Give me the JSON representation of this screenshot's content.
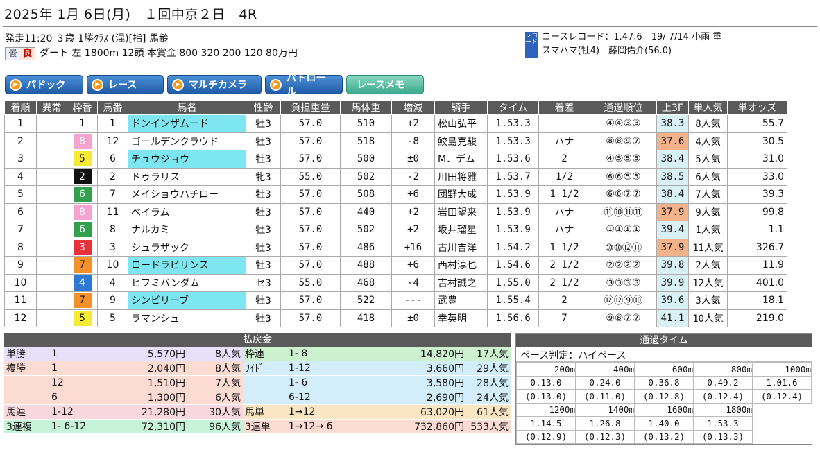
{
  "header": {
    "title": "2025年 1月 6日(月)　１回中京２日　4R"
  },
  "race": {
    "line1": "発走11:20 ３歳 1勝ｸﾗｽ (混)[指] 馬齢",
    "weather": "曇",
    "track_cond": "良",
    "line2": "ダート 左 1800m 12頭 本賞金 800 320 200 120 80万円"
  },
  "record": {
    "tag": "レコード",
    "line1": "コースレコード：1.47.6　19/ 7/14 小雨 重",
    "line2": "スマハマ(牡4)　藤岡佑介(56.0)"
  },
  "buttons": [
    "パドック",
    "レース",
    "マルチカメラ",
    "パトロール",
    "レースメモ"
  ],
  "columns": [
    "着順",
    "異常",
    "枠番",
    "馬番",
    "馬名",
    "性齢",
    "負担重量",
    "馬体重",
    "増減",
    "騎手",
    "タイム",
    "着差",
    "通過順位",
    "上3F",
    "単人気",
    "単オッズ"
  ],
  "rows": [
    [
      "1",
      "",
      "1",
      "1",
      "ドンインザムード",
      "牡3",
      "57.0",
      "510",
      "+2",
      "松山弘平",
      "1.53.3",
      "",
      "④④③③",
      "38.3",
      "8人気",
      "55.7"
    ],
    [
      "2",
      "",
      "8",
      "12",
      "ゴールデンクラウド",
      "牡3",
      "57.0",
      "518",
      "-8",
      "鮫島克駿",
      "1.53.3",
      "ハナ",
      "⑧⑧⑨⑦",
      "37.6",
      "4人気",
      "30.5"
    ],
    [
      "3",
      "",
      "5",
      "6",
      "チュウジョウ",
      "牡3",
      "57.0",
      "500",
      "±0",
      "M．デム",
      "1.53.6",
      "2",
      "④⑤⑤⑤",
      "38.4",
      "5人気",
      "31.0"
    ],
    [
      "4",
      "",
      "2",
      "2",
      "ドゥラリス",
      "牝3",
      "55.0",
      "502",
      "-2",
      "川田将雅",
      "1.53.7",
      "1/2",
      "⑥⑥⑤⑤",
      "38.5",
      "6人気",
      "33.0"
    ],
    [
      "5",
      "",
      "6",
      "7",
      "メイショウハチロー",
      "牡3",
      "57.0",
      "508",
      "+6",
      "団野大成",
      "1.53.9",
      "1 1/2",
      "⑥⑥⑦⑦",
      "38.4",
      "7人気",
      "39.3"
    ],
    [
      "6",
      "",
      "8",
      "11",
      "ベイラム",
      "牡3",
      "57.0",
      "440",
      "+2",
      "岩田望来",
      "1.53.9",
      "ハナ",
      "⑪⑩⑪⑪",
      "37.9",
      "9人気",
      "99.8"
    ],
    [
      "7",
      "",
      "6",
      "8",
      "ナルカミ",
      "牡3",
      "57.0",
      "502",
      "+2",
      "坂井瑠星",
      "1.53.9",
      "ハナ",
      "①①①①",
      "39.4",
      "1人気",
      "1.1"
    ],
    [
      "8",
      "",
      "3",
      "3",
      "シュラザック",
      "牡3",
      "57.0",
      "486",
      "+16",
      "古川吉洋",
      "1.54.2",
      "1 1/2",
      "⑩⑩⑫⑪",
      "37.9",
      "11人気",
      "326.7"
    ],
    [
      "9",
      "",
      "7",
      "10",
      "ロードラビリンス",
      "牡3",
      "57.0",
      "488",
      "+6",
      "西村淳也",
      "1.54.6",
      "2 1/2",
      "②②②②",
      "39.8",
      "2人気",
      "11.9"
    ],
    [
      "10",
      "",
      "4",
      "4",
      "ヒフミバンダム",
      "セ3",
      "55.0",
      "468",
      "-4",
      "吉村誠之",
      "1.55.0",
      "2 1/2",
      "③③③③",
      "39.9",
      "12人気",
      "401.0"
    ],
    [
      "11",
      "",
      "7",
      "9",
      "シンビリーブ",
      "牡3",
      "57.0",
      "522",
      "---",
      "武豊",
      "1.55.4",
      "2",
      "⑫⑫⑨⑩",
      "39.6",
      "3人気",
      "18.1"
    ],
    [
      "12",
      "",
      "5",
      "5",
      "ラマンシュ",
      "牡3",
      "57.0",
      "418",
      "±0",
      "幸英明",
      "1.56.6",
      "7",
      "⑨⑧⑦⑦",
      "41.1",
      "10人気",
      "219.0"
    ]
  ],
  "highlight_names": [
    0,
    2,
    8,
    10
  ],
  "f3_colors": {
    "0": "light",
    "1": "orange",
    "2": "light",
    "3": "light",
    "4": "light",
    "5": "orange",
    "6": "light",
    "7": "orange",
    "8": "light",
    "9": "light",
    "10": "light",
    "11": "light"
  },
  "waku_colors": {
    "1": "#ffffff",
    "2": "#111111",
    "3": "#e8323c",
    "4": "#2f78d6",
    "5": "#f7ea36",
    "6": "#33a04d",
    "7": "#f5902a",
    "8": "#f6a3cf"
  },
  "payout": {
    "title": "払戻金",
    "rows": [
      {
        "bg": "#e6e0fb",
        "a": [
          "単勝",
          "1",
          "5,570円",
          "8人気"
        ],
        "bg2": "#cdf1cf",
        "b": [
          "枠連",
          "1- 8",
          "14,820円",
          "17人気"
        ]
      },
      {
        "bg": "#fbdbd2",
        "a": [
          "複勝",
          "1",
          "2,040円",
          "8人気"
        ],
        "bg2": "#d3eefa",
        "b": [
          "ﾜｲﾄﾞ",
          "1-12",
          "3,660円",
          "29人気"
        ]
      },
      {
        "bg": "#fbdbd2",
        "a": [
          "",
          "12",
          "1,510円",
          "7人気"
        ],
        "bg2": "#d3eefa",
        "b": [
          "",
          "1- 6",
          "3,580円",
          "28人気"
        ]
      },
      {
        "bg": "#fbdbd2",
        "a": [
          "",
          "6",
          "1,300円",
          "6人気"
        ],
        "bg2": "#d3eefa",
        "b": [
          "",
          "6-12",
          "2,690円",
          "24人気"
        ]
      },
      {
        "bg": "#f9d7df",
        "a": [
          "馬連",
          "1-12",
          "21,280円",
          "30人気"
        ],
        "bg2": "#fbe6c4",
        "b": [
          "馬単",
          "1→12",
          "63,020円",
          "61人気"
        ]
      },
      {
        "bg": "#c7f3d8",
        "a": [
          "3連複",
          "1- 6-12",
          "72,310円",
          "96人気"
        ],
        "bg2": "#fbdbd2",
        "b": [
          "3連単",
          "1→12→ 6",
          "732,860円",
          "533人気"
        ]
      }
    ]
  },
  "passing": {
    "title": "通過タイム",
    "pace": "ペース判定：ハイペース",
    "row1": [
      [
        "200m",
        "0.13.0",
        "(0.13.0)"
      ],
      [
        "400m",
        "0.24.0",
        "(0.11.0)"
      ],
      [
        "600m",
        "0.36.8",
        "(0.12.8)"
      ],
      [
        "800m",
        "0.49.2",
        "(0.12.4)"
      ],
      [
        "1000m",
        "1.01.6",
        "(0.12.4)"
      ]
    ],
    "row2": [
      [
        "1200m",
        "1.14.5",
        "(0.12.9)"
      ],
      [
        "1400m",
        "1.26.8",
        "(0.12.3)"
      ],
      [
        "1600m",
        "1.40.0",
        "(0.13.2)"
      ],
      [
        "1800m",
        "1.53.3",
        "(0.13.3)"
      ]
    ]
  }
}
